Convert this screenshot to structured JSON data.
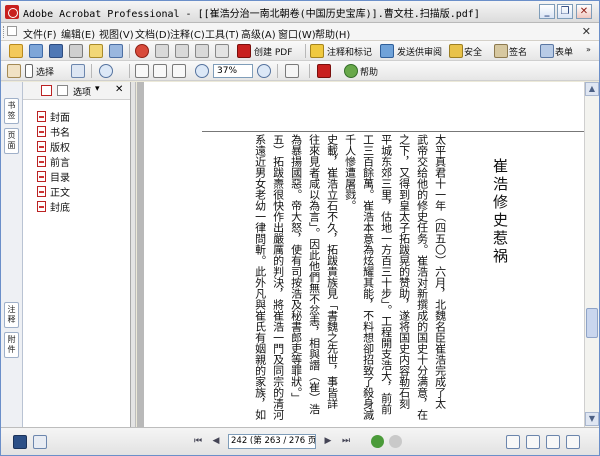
{
  "window": {
    "title": "Adobe Acrobat Professional - [[崔浩分治一南北朝卷(中国历史宝库)].曹文柱.扫描版.pdf]",
    "minimize": "_",
    "restore": "❐",
    "close": "✕"
  },
  "menu": {
    "items": [
      "文件(F)",
      "编辑(E)",
      "视图(V)",
      "文档(D)",
      "注释(C)",
      "工具(T)",
      "高级(A)",
      "窗口(W)",
      "帮助(H)"
    ],
    "close_glyph": "✕"
  },
  "toolbar1": {
    "create_pdf": "创建 PDF",
    "comment_markup": "注释和标记",
    "send_review": "发送供审阅",
    "security": "安全",
    "sign": "签名",
    "forms": "表单"
  },
  "toolbar2": {
    "select_label": "选择",
    "zoom_value": "37%",
    "help_label": "帮助"
  },
  "lefttabs": {
    "bookmarks": "书签",
    "pages": "页面",
    "comments": "注释",
    "layers": "附件"
  },
  "bookmarks_panel": {
    "options_label": "选项",
    "close_glyph": "✕",
    "items": [
      "封面",
      "书名",
      "版权",
      "前言",
      "目录",
      "正文",
      "封底"
    ]
  },
  "document": {
    "heading": "崔浩修史惹祸",
    "columns": [
      "太平真君十一年（四五〇）六月，北魏名臣崔浩完成了太",
      "武帝交给他的修史任务。崔浩对新撰成的国史十分满意，在",
      "之下，又得到皇太子拓跋晃的赞助，遂将国史内容勒石刻",
      "平城东郊三里，估地一方百三十步」。工程開支浩大，前前",
      "工三百餘萬。崔浩本意為炫耀其能，不料想卻招致了殺身滅",
      "千人慘遭屠戮。",
      "史載，崔浩立石不久，拓跋貴族見「書魏之先世，事皆詳",
      "往來見者咸以為言」。因此他們無不忿恚，相與譖（崔）浩",
      "為暴揚國惡。帝大怒，使有司按浩及秘書郎吏等罪狀。」",
      "五）拓跋燾很快作出嚴厲的判決，將崔浩一門及同宗的清河",
      "系遠近男女老幼一律問斬。此外凡與崔氏有姻親的家族，如"
    ]
  },
  "statusbar": {
    "page_field": "242 (第 263 / 276 页)"
  },
  "colors": {
    "acrobat_red": "#c8201e",
    "panel_border": "#a7a7a7",
    "doc_background": "#b9b9b9",
    "window_border": "#6b8fc9"
  }
}
